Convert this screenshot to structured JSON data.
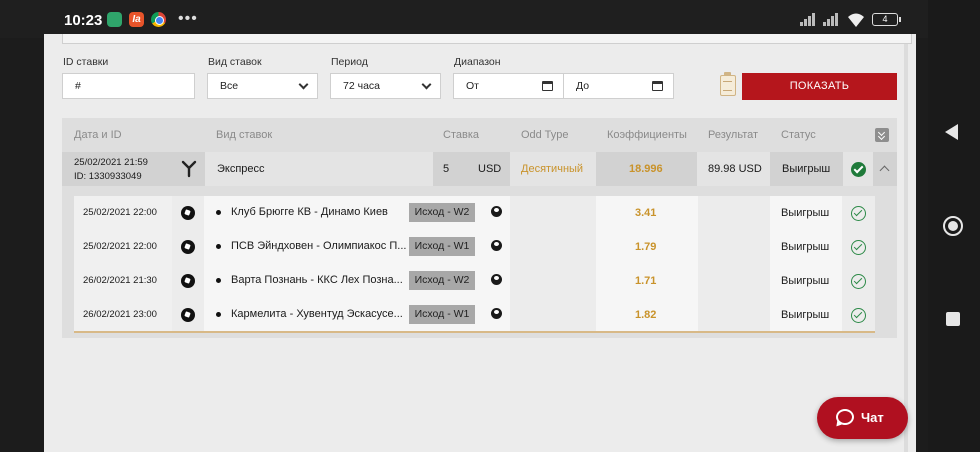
{
  "status_bar": {
    "time": "10:23",
    "ia_icon": "Ia",
    "battery": "4"
  },
  "filters": {
    "bet_id_label": "ID ставки",
    "bet_id_value": "#",
    "bet_type_label": "Вид ставок",
    "bet_type_value": "Все",
    "period_label": "Период",
    "period_value": "72 часа",
    "range_label": "Диапазон",
    "range_from": "От",
    "range_to": "До",
    "show_button": "ПОКАЗАТЬ"
  },
  "table": {
    "headers": {
      "date_id": "Дата и ID",
      "bet_type": "Вид ставок",
      "stake": "Ставка",
      "odd_type": "Odd Type",
      "coefficients": "Коэффициенты",
      "result": "Результат",
      "status": "Статус"
    },
    "main_row": {
      "date": "25/02/2021 21:59",
      "id": "ID: 1330933049",
      "bet_type": "Экспресс",
      "stake": "5",
      "currency": "USD",
      "odd_type": "Десятичный",
      "coefficient": "18.996",
      "result": "89.98 USD",
      "status": "Выигрыш"
    },
    "sub_rows": [
      {
        "date": "25/02/2021 22:00",
        "match": "Клуб Брюгге КВ - Динамо Киев",
        "outcome": "Исход - W2",
        "coefficient": "3.41",
        "status": "Выигрыш"
      },
      {
        "date": "25/02/2021 22:00",
        "match": "ПСВ Эйндховен - Олимпиакос П...",
        "outcome": "Исход - W1",
        "coefficient": "1.79",
        "status": "Выигрыш"
      },
      {
        "date": "26/02/2021 21:30",
        "match": "Варта Познань - ККС Лех Позна...",
        "outcome": "Исход - W2",
        "coefficient": "1.71",
        "status": "Выигрыш"
      },
      {
        "date": "26/02/2021 23:00",
        "match": "Кармелита - Хувентуд Эскасусе...",
        "outcome": "Исход - W1",
        "coefficient": "1.82",
        "status": "Выигрыш"
      }
    ]
  },
  "chat": {
    "label": "Чат"
  },
  "colors": {
    "accent_red": "#b5161c",
    "coefficient_gold": "#c9932b",
    "success_green": "#1f7a3a"
  }
}
